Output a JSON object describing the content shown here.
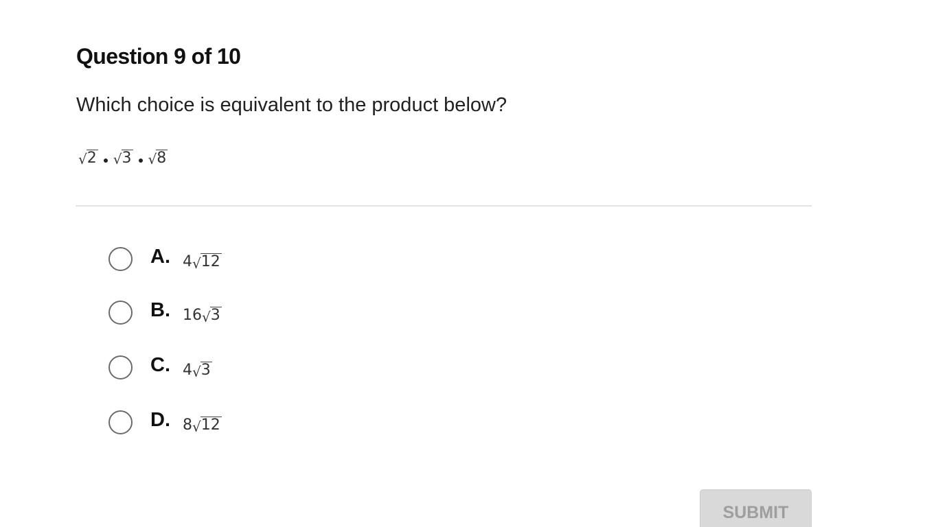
{
  "question": {
    "header": "Question 9 of 10",
    "prompt": "Which choice is equivalent to the product below?",
    "expression": {
      "r1": "2",
      "r2": "3",
      "r3": "8"
    }
  },
  "choices": [
    {
      "letter": "A.",
      "coef": "4",
      "radicand": "12"
    },
    {
      "letter": "B.",
      "coef": "16",
      "radicand": "3"
    },
    {
      "letter": "C.",
      "coef": "4",
      "radicand": "3"
    },
    {
      "letter": "D.",
      "coef": "8",
      "radicand": "12"
    }
  ],
  "submit": {
    "label": "SUBMIT"
  },
  "colors": {
    "submit_bg": "#d9d9d9",
    "submit_text": "#9e9e9e",
    "radio_border": "#6b6b6b",
    "divider": "#e3e3e3"
  }
}
